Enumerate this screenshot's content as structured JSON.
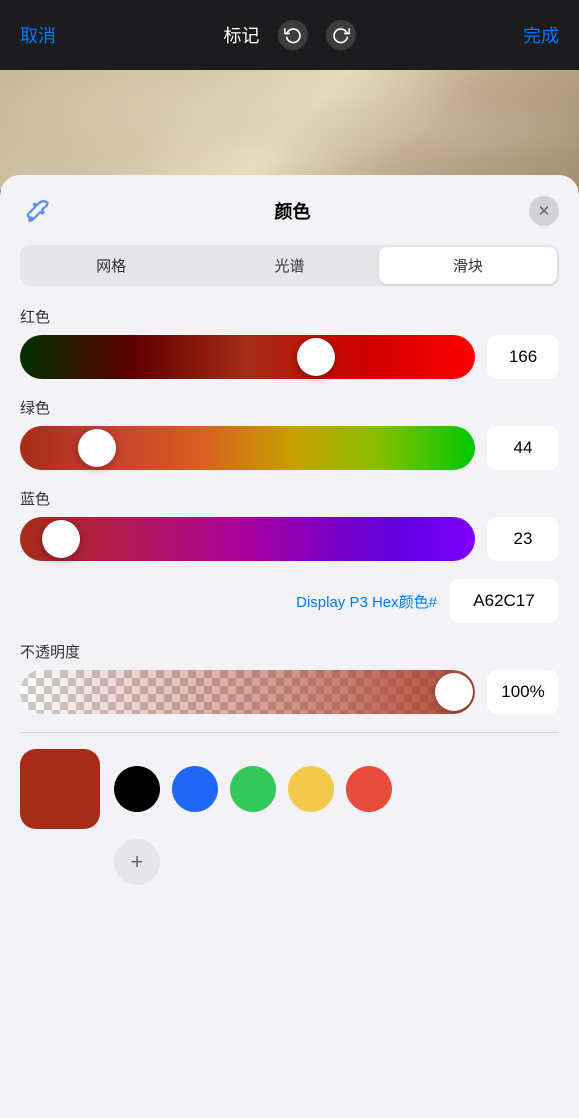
{
  "topbar": {
    "cancel_label": "取消",
    "title": "标记",
    "done_label": "完成",
    "undo_icon": "undo-icon",
    "redo_icon": "redo-icon"
  },
  "color_panel": {
    "title": "颜色",
    "tabs": [
      {
        "id": "grid",
        "label": "网格"
      },
      {
        "id": "spectrum",
        "label": "光谱"
      },
      {
        "id": "sliders",
        "label": "滑块",
        "active": true
      }
    ],
    "sliders": {
      "red": {
        "label": "红色",
        "value": 166,
        "percent": 65
      },
      "green": {
        "label": "绿色",
        "value": 44,
        "percent": 17
      },
      "blue": {
        "label": "蓝色",
        "value": 23,
        "percent": 9
      }
    },
    "hex": {
      "label": "Display P3 Hex颜色#",
      "value": "A62C17"
    },
    "opacity": {
      "label": "不透明度",
      "value": "100%",
      "percent": 100
    },
    "current_color": "#a62c17",
    "preset_colors": [
      {
        "color": "#000000",
        "label": "black"
      },
      {
        "color": "#2167f5",
        "label": "blue"
      },
      {
        "color": "#34c759",
        "label": "green"
      },
      {
        "color": "#f2c94c",
        "label": "yellow"
      },
      {
        "color": "#e74c3c",
        "label": "red"
      }
    ],
    "add_color_label": "+"
  }
}
